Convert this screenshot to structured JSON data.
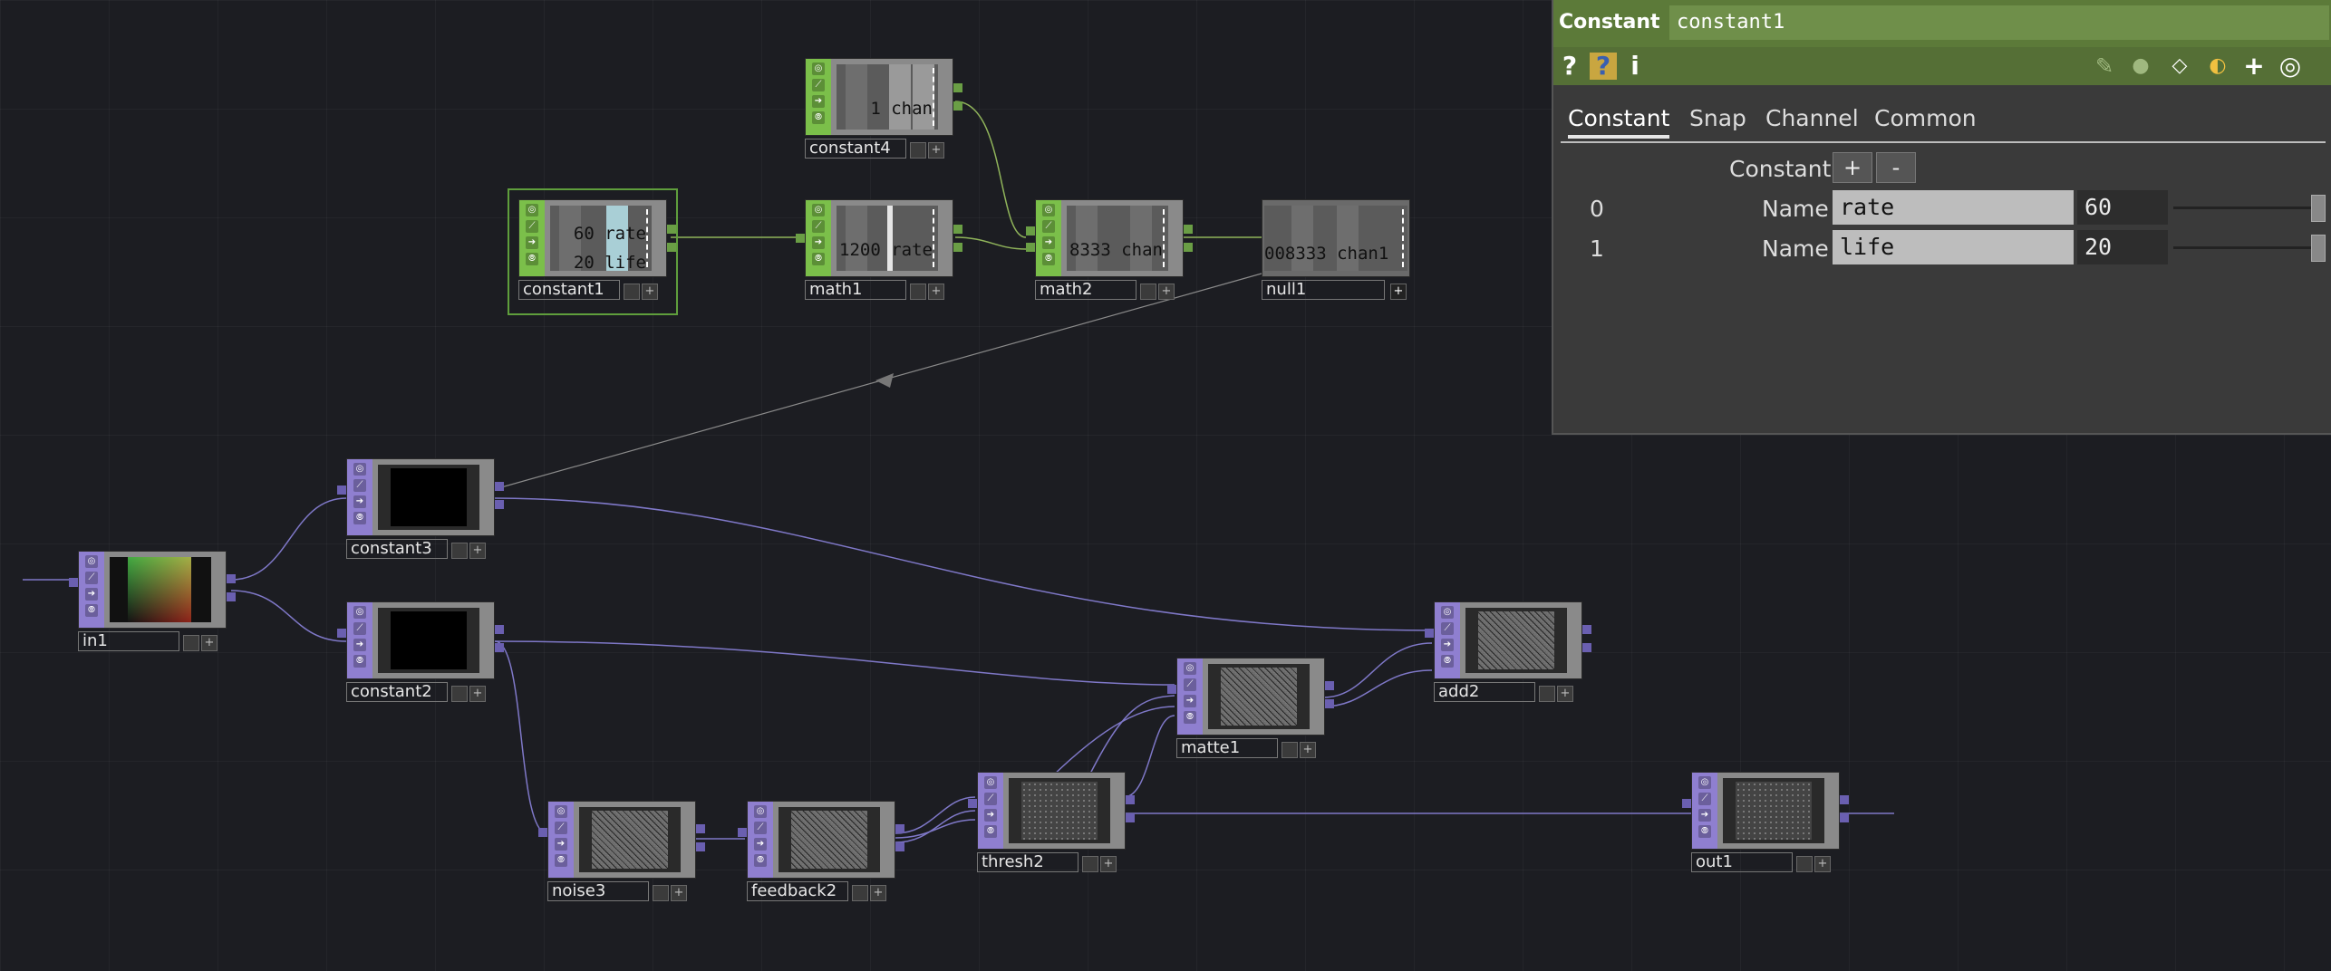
{
  "nodes": {
    "constant4": {
      "name": "constant4",
      "values": [
        "1 chan"
      ]
    },
    "constant1": {
      "name": "constant1",
      "values": [
        "60 rate",
        "20 life"
      ]
    },
    "math1": {
      "name": "math1",
      "values": [
        "1200 rate"
      ]
    },
    "math2": {
      "name": "math2",
      "values": [
        "8333 chan"
      ]
    },
    "null1": {
      "name": "null1",
      "values": [
        "008333 chan1"
      ]
    },
    "in1": {
      "name": "in1"
    },
    "constant3": {
      "name": "constant3"
    },
    "constant2": {
      "name": "constant2"
    },
    "noise3": {
      "name": "noise3"
    },
    "feedback2": {
      "name": "feedback2"
    },
    "thresh2": {
      "name": "thresh2"
    },
    "matte1": {
      "name": "matte1"
    },
    "add2": {
      "name": "add2"
    },
    "out1": {
      "name": "out1"
    }
  },
  "panel": {
    "op_type": "Constant",
    "op_name": "constant1",
    "toolbar": {
      "help": "?",
      "python_help": "?",
      "info": "i",
      "add": "+",
      "target": "◎"
    },
    "tabs": [
      "Constant",
      "Snap",
      "Channel",
      "Common"
    ],
    "active_tab": "Constant",
    "section_label": "Constant",
    "add_label": "+",
    "remove_label": "-",
    "params": [
      {
        "index": "0",
        "label": "Name",
        "name": "rate",
        "value": "60"
      },
      {
        "index": "1",
        "label": "Name",
        "name": "life",
        "value": "20"
      }
    ]
  },
  "colors": {
    "chop": "#7bbf4a",
    "top": "#8f7fd0",
    "panel_header": "#5c7a39",
    "background": "#1c1d22"
  }
}
